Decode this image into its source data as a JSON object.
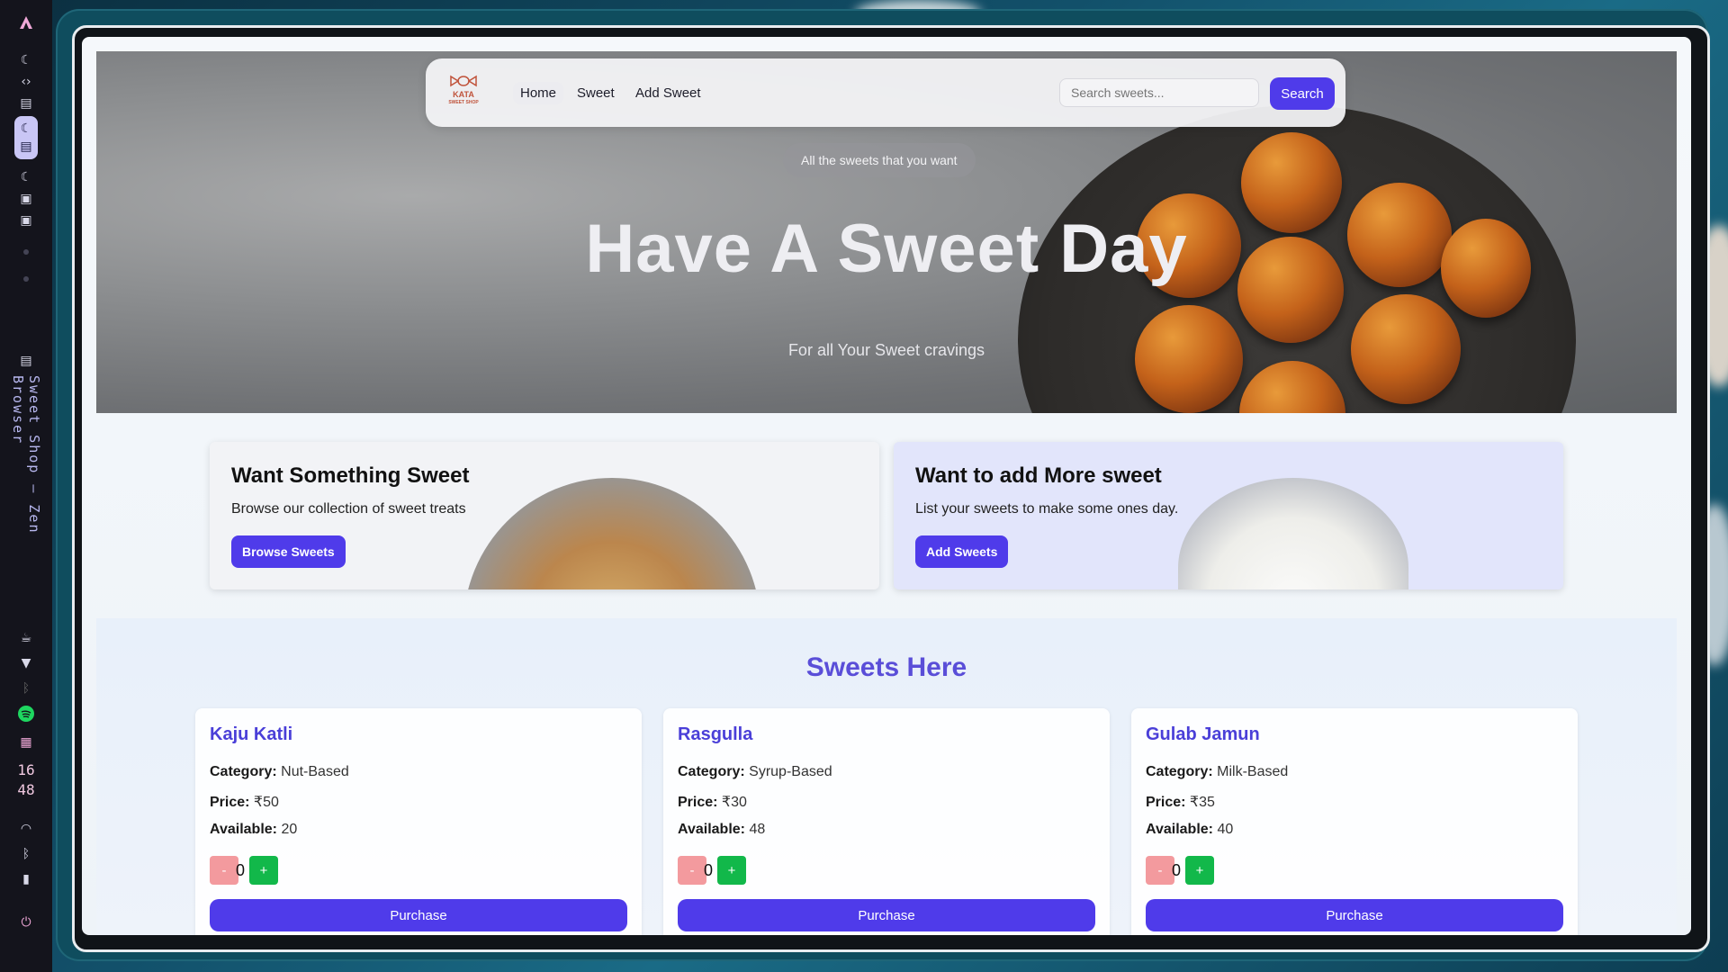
{
  "system_bar": {
    "window_title": "Sweet Shop — Zen Browser",
    "clock_hour": "16",
    "clock_minute": "48"
  },
  "nav": {
    "logo_text": "KATA",
    "logo_sub": "SWEET SHOP",
    "links": [
      "Home",
      "Sweet",
      "Add Sweet"
    ],
    "active_link": "Home",
    "search_placeholder": "Search sweets...",
    "search_label": "Search"
  },
  "hero": {
    "tagline": "All the sweets that you want",
    "title": "Have A Sweet Day",
    "subtitle": "For all Your Sweet cravings"
  },
  "promos": [
    {
      "title": "Want Something Sweet",
      "text": "Browse our collection of sweet treats",
      "button": "Browse Sweets"
    },
    {
      "title": "Want to add More sweet",
      "text": "List your sweets to make some ones day.",
      "button": "Add Sweets"
    }
  ],
  "sweets": {
    "title": "Sweets Here",
    "labels": {
      "category": "Category:",
      "price": "Price:",
      "available": "Available:"
    },
    "purchase_label": "Purchase",
    "minus_label": "-",
    "plus_label": "+",
    "items": [
      {
        "name": "Kaju Katli",
        "category": "Nut-Based",
        "price": "₹50",
        "available": "20",
        "qty": "0"
      },
      {
        "name": "Rasgulla",
        "category": "Syrup-Based",
        "price": "₹30",
        "available": "48",
        "qty": "0"
      },
      {
        "name": "Gulab Jamun",
        "category": "Milk-Based",
        "price": "₹35",
        "available": "40",
        "qty": "0"
      }
    ]
  },
  "colors": {
    "accent": "#4f3bea",
    "title_purple": "#5a4ed8",
    "plus_green": "#12b84a",
    "minus_pink": "#f39a9e"
  }
}
